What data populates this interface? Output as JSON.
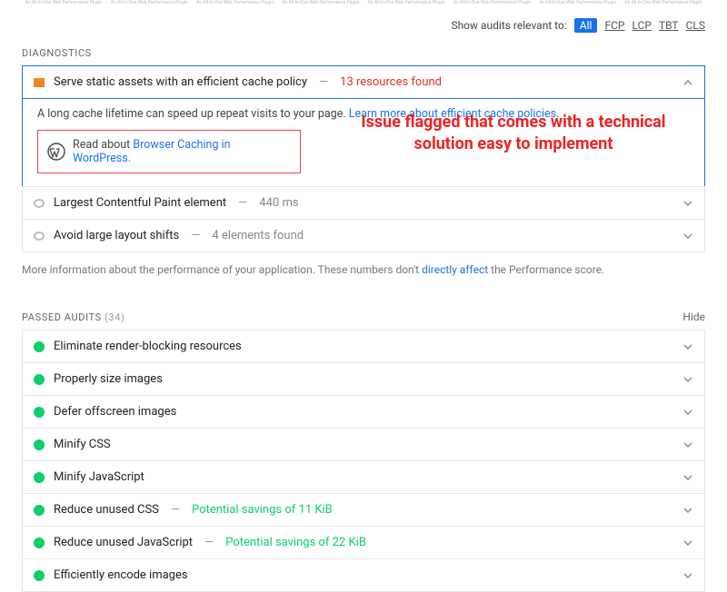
{
  "topstrip_label": "An All-In-One Web Performance Plugin",
  "filter": {
    "label": "Show audits relevant to:",
    "all": "All",
    "fcp": "FCP",
    "lcp": "LCP",
    "tbt": "TBT",
    "cls": "CLS"
  },
  "diagnostics": {
    "title": "DIAGNOSTICS",
    "items": [
      {
        "title": "Serve static assets with an efficient cache policy",
        "detail": "13 resources found",
        "detail_class": "red",
        "status": "square",
        "open": true,
        "body": {
          "desc_a": "A long cache lifetime can speed up repeat visits to your page. ",
          "link1": "Learn more about efficient cache policies",
          "desc_b": ".",
          "wp_prefix": "Read about ",
          "wp_link": "Browser Caching in WordPress."
        }
      },
      {
        "title": "Largest Contentful Paint element",
        "detail": "440 ms",
        "detail_class": "grey",
        "status": "grey"
      },
      {
        "title": "Avoid large layout shifts",
        "detail": "4 elements found",
        "detail_class": "grey",
        "status": "grey"
      }
    ],
    "more_info_a": "More information about the performance of your application. These numbers don't ",
    "more_info_link": "directly affect",
    "more_info_b": " the Performance score."
  },
  "annotation": {
    "line1": "Issue flagged that comes with a technical",
    "line2": "solution easy to implement"
  },
  "passed": {
    "title": "PASSED AUDITS",
    "count": "(34)",
    "hide": "Hide",
    "items": [
      {
        "title": "Eliminate render-blocking resources"
      },
      {
        "title": "Properly size images"
      },
      {
        "title": "Defer offscreen images"
      },
      {
        "title": "Minify CSS"
      },
      {
        "title": "Minify JavaScript"
      },
      {
        "title": "Reduce unused CSS",
        "detail": "Potential savings of 11 KiB"
      },
      {
        "title": "Reduce unused JavaScript",
        "detail": "Potential savings of 22 KiB"
      },
      {
        "title": "Efficiently encode images"
      }
    ]
  },
  "dash": "—"
}
